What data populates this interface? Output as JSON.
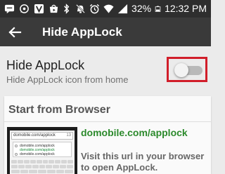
{
  "status_bar": {
    "battery_percent": "32%",
    "time": "12:32 PM"
  },
  "toolbar": {
    "title": "Hide AppLock"
  },
  "setting": {
    "title": "Hide AppLock",
    "subtitle": "Hide AppLock icon from home",
    "toggle_on": false
  },
  "card": {
    "title": "Start from Browser",
    "url": "domobile.com/applock",
    "instruction": "Visit this url in your browser to open AppLock.",
    "preview": {
      "address": "domobile.com/applock",
      "tab_count": "13",
      "suggestions": [
        "domobile.com/applock",
        "domobile.com/applock",
        "domobile.com/applock"
      ]
    }
  },
  "colors": {
    "status_bar": "#2e2e2e",
    "toolbar": "#3a3a3a",
    "background": "#ebebeb",
    "highlight_border": "#d11e2a",
    "link_green": "#2c8a2c"
  }
}
